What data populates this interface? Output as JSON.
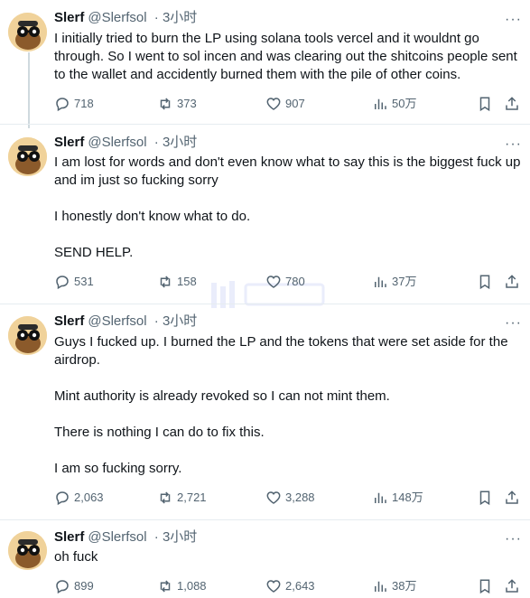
{
  "tweets": [
    {
      "name": "Slerf",
      "handle": "@Slerfsol",
      "time": "· 3小时",
      "more": "···",
      "paragraphs": [
        "I initially tried to burn the LP using solana tools vercel and it wouldnt go through. So I went to sol incen and was clearing out the shitcoins people sent to the wallet and accidently burned them with the pile of other coins."
      ],
      "replies": "718",
      "retweets": "373",
      "likes": "907",
      "views": "50万"
    },
    {
      "name": "Slerf",
      "handle": "@Slerfsol",
      "time": "· 3小时",
      "more": "···",
      "paragraphs": [
        "I am lost for words and don't even know what to say this is the biggest fuck up and im just so fucking sorry",
        "I honestly don't know what to do.",
        "SEND HELP."
      ],
      "replies": "531",
      "retweets": "158",
      "likes": "780",
      "views": "37万"
    },
    {
      "name": "Slerf",
      "handle": "@Slerfsol",
      "time": "· 3小时",
      "more": "···",
      "paragraphs": [
        "Guys I fucked up. I burned the LP and the tokens that were set aside for the airdrop.",
        "Mint authority is already revoked so I can not mint them.",
        "There is nothing I can do to fix this.",
        "I am so fucking sorry."
      ],
      "replies": "2,063",
      "retweets": "2,721",
      "likes": "3,288",
      "views": "148万"
    },
    {
      "name": "Slerf",
      "handle": "@Slerfsol",
      "time": "· 3小时",
      "more": "···",
      "paragraphs": [
        "oh fuck"
      ],
      "replies": "899",
      "retweets": "1,088",
      "likes": "2,643",
      "views": "38万"
    }
  ],
  "icons": {
    "reply": "reply-icon",
    "retweet": "retweet-icon",
    "like": "heart-icon",
    "views": "views-icon",
    "bookmark": "bookmark-icon",
    "share": "share-icon"
  },
  "colors": {
    "text": "#0f1419",
    "muted": "#536471",
    "separator": "#e6ecf0"
  }
}
